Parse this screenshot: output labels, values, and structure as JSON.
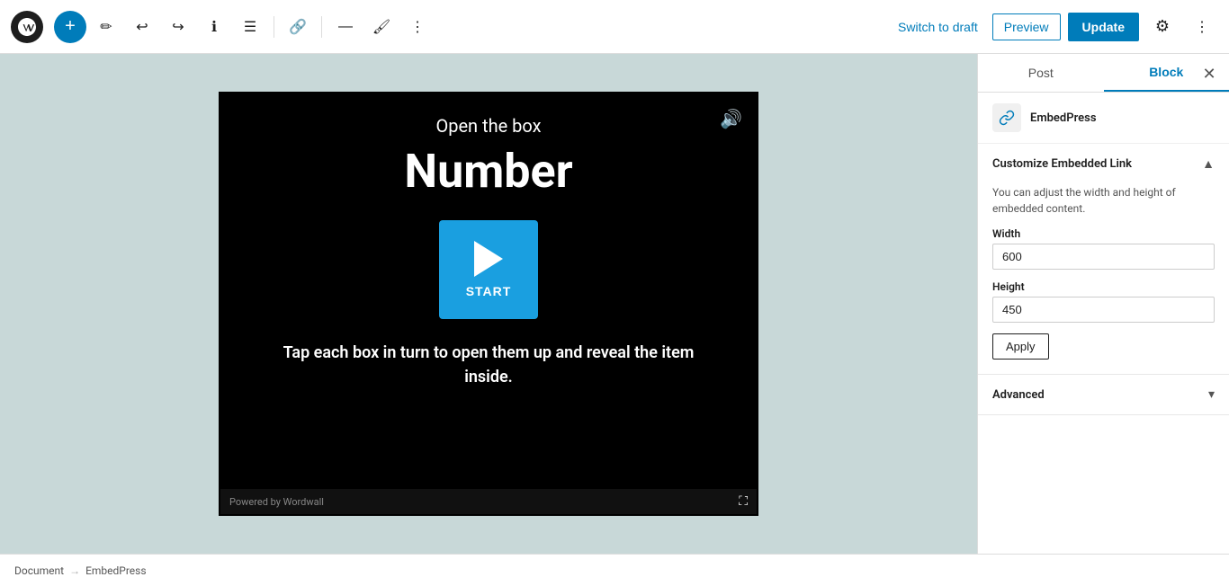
{
  "toolbar": {
    "add_label": "+",
    "undo_label": "↩",
    "redo_label": "↪",
    "info_label": "ℹ",
    "list_label": "≡",
    "link_label": "🔗",
    "divider_label": "—",
    "edit_label": "✏",
    "more_label": "⋮",
    "switch_draft_label": "Switch to draft",
    "preview_label": "Preview",
    "update_label": "Update",
    "settings_icon": "⚙",
    "more_icon": "⋮"
  },
  "sidebar": {
    "post_tab": "Post",
    "block_tab": "Block",
    "close_icon": "✕",
    "block_name": "EmbedPress",
    "customize_section": {
      "title": "Customize Embedded Link",
      "chevron": "▲",
      "description": "You can adjust the width and height of embedded content.",
      "width_label": "Width",
      "width_value": "600",
      "height_label": "Height",
      "height_value": "450",
      "apply_label": "Apply"
    },
    "advanced_section": {
      "title": "Advanced",
      "chevron": "▾"
    }
  },
  "embed": {
    "open_text": "Open the box",
    "title": "Number",
    "start_label": "START",
    "tap_text": "Tap each box in turn to open them up and reveal the item inside.",
    "powered_text": "Powered by Wordwall"
  },
  "breadcrumb": {
    "document": "Document",
    "separator": "→",
    "current": "EmbedPress"
  }
}
